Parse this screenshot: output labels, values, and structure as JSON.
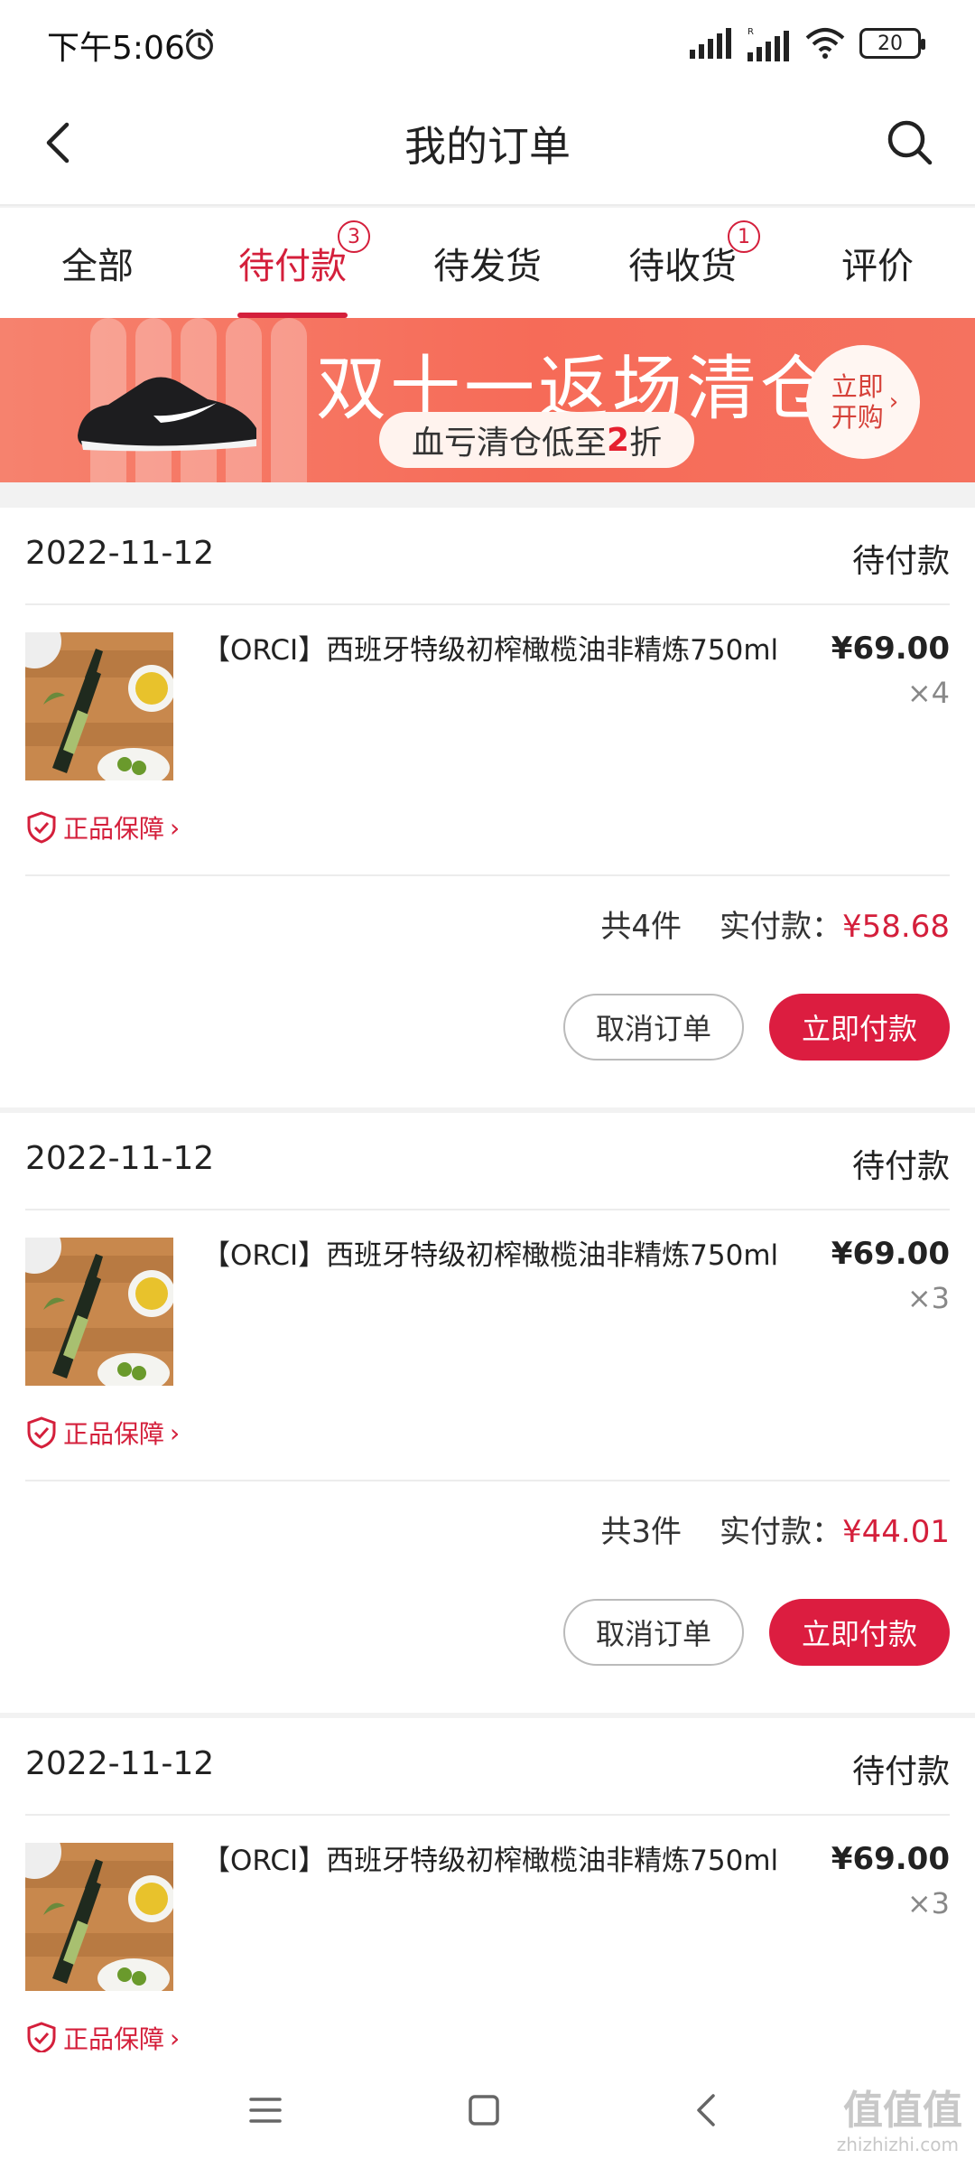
{
  "status_bar": {
    "time": "下午5:06",
    "battery": "20"
  },
  "header": {
    "title": "我的订单"
  },
  "tabs": [
    {
      "label": "全部",
      "badge": ""
    },
    {
      "label": "待付款",
      "badge": "3"
    },
    {
      "label": "待发货",
      "badge": ""
    },
    {
      "label": "待收货",
      "badge": "1"
    },
    {
      "label": "评价",
      "badge": ""
    }
  ],
  "banner": {
    "title": "双十一返场清仓",
    "subtitle_prefix": "血亏清仓低至",
    "subtitle_highlight": "2",
    "subtitle_suffix": "折",
    "cta_line1": "立即",
    "cta_line2": "开购"
  },
  "orders": [
    {
      "date": "2022-11-12",
      "status": "待付款",
      "product_name": "【ORCI】西班牙特级初榨橄榄油非精炼750ml",
      "price": "¥69.00",
      "qty": "×4",
      "guarantee": "正品保障",
      "total_count": "共4件",
      "paid_label": "实付款：",
      "paid_amount": "¥58.68",
      "cancel_label": "取消订单",
      "pay_label": "立即付款"
    },
    {
      "date": "2022-11-12",
      "status": "待付款",
      "product_name": "【ORCI】西班牙特级初榨橄榄油非精炼750ml",
      "price": "¥69.00",
      "qty": "×3",
      "guarantee": "正品保障",
      "total_count": "共3件",
      "paid_label": "实付款：",
      "paid_amount": "¥44.01",
      "cancel_label": "取消订单",
      "pay_label": "立即付款"
    },
    {
      "date": "2022-11-12",
      "status": "待付款",
      "product_name": "【ORCI】西班牙特级初榨橄榄油非精炼750ml",
      "price": "¥69.00",
      "qty": "×3",
      "guarantee": "正品保障"
    }
  ],
  "watermark": {
    "main": "值值值",
    "sub": "zhizhizhi.com"
  },
  "colors": {
    "accent": "#d41f3b",
    "pay_button": "#dc1d40",
    "banner": "#f66b58"
  }
}
